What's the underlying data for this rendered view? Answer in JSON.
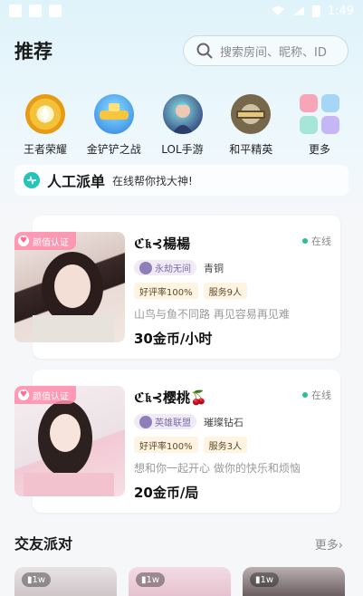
{
  "status_bar": {
    "time": "1:49"
  },
  "header": {
    "title": "推荐",
    "search_placeholder": "搜索房间、昵称、ID"
  },
  "games": [
    {
      "name": "王者荣耀",
      "icon": "honor-of-kings-icon"
    },
    {
      "name": "金铲铲之战",
      "icon": "golden-spatula-icon"
    },
    {
      "name": "LOL手游",
      "icon": "lol-mobile-icon"
    },
    {
      "name": "和平精英",
      "icon": "peace-elite-icon"
    },
    {
      "name": "更多",
      "icon": "more-grid-icon"
    }
  ],
  "banner": {
    "title": "人工派单",
    "subtitle": "在线帮你找大神!"
  },
  "cards": [
    {
      "badge": "颜值认证",
      "name": "ℭ𝔨⊰楊楊",
      "online": "在线",
      "game_pill": "永劫无间",
      "rank": "青铜",
      "tags": [
        "好评率100%",
        "服务9人"
      ],
      "bio": "山鸟与鱼不同路 再见容易再见难",
      "price": "30金币/小时"
    },
    {
      "badge": "颜值认证",
      "name": "ℭ𝔨⊰樱桃🍒",
      "online": "在线",
      "game_pill": "英雄联盟",
      "rank": "璀璨钻石",
      "tags": [
        "好评率100%",
        "服务3人"
      ],
      "bio": "想和你一起开心 做你的快乐和烦恼",
      "price": "20金币/局"
    }
  ],
  "party": {
    "title": "交友派对",
    "more": "更多"
  },
  "party_tiles": [
    {
      "count": "1w"
    },
    {
      "count": "1w"
    },
    {
      "count": "1w"
    }
  ]
}
